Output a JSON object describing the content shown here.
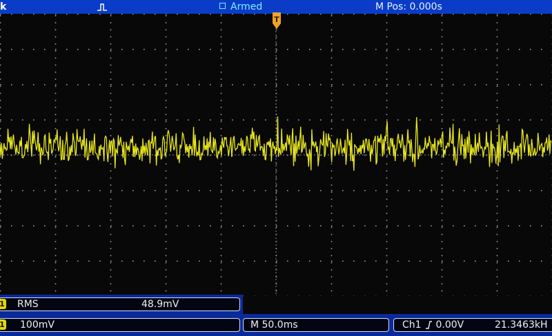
{
  "header": {
    "left_fragment": "k",
    "acquisition_state": "Armed",
    "horizontal_position": "M Pos: 0.000s",
    "trigger_type_icon": "edge-pulse-icon"
  },
  "measurement": {
    "channel_badge": "1",
    "type": "RMS",
    "value": "48.9mV"
  },
  "vertical": {
    "channel_badge": "1",
    "scale": "100mV"
  },
  "horizontal": {
    "scale": "M 50.0ms"
  },
  "trigger": {
    "source": "Ch1",
    "slope_icon": "rising-edge-icon",
    "level": "0.00V",
    "frequency": "21.3463kH"
  },
  "trigger_marker_label": "T",
  "colors": {
    "trace": "#e8e61e",
    "header_bg": "#0a3cc8",
    "armed_text": "#7ff0ff",
    "grid_dots": "#9aa0a6",
    "badge": "#e6d800"
  },
  "chart_data": {
    "type": "line",
    "title": "",
    "xlabel": "",
    "ylabel": "",
    "x_divisions": 10,
    "y_divisions": 8,
    "grid": true,
    "series": [
      {
        "waveform": "noise",
        "rms_mV": 48.9,
        "peak_to_peak_divisions": 1.6
      }
    ]
  }
}
